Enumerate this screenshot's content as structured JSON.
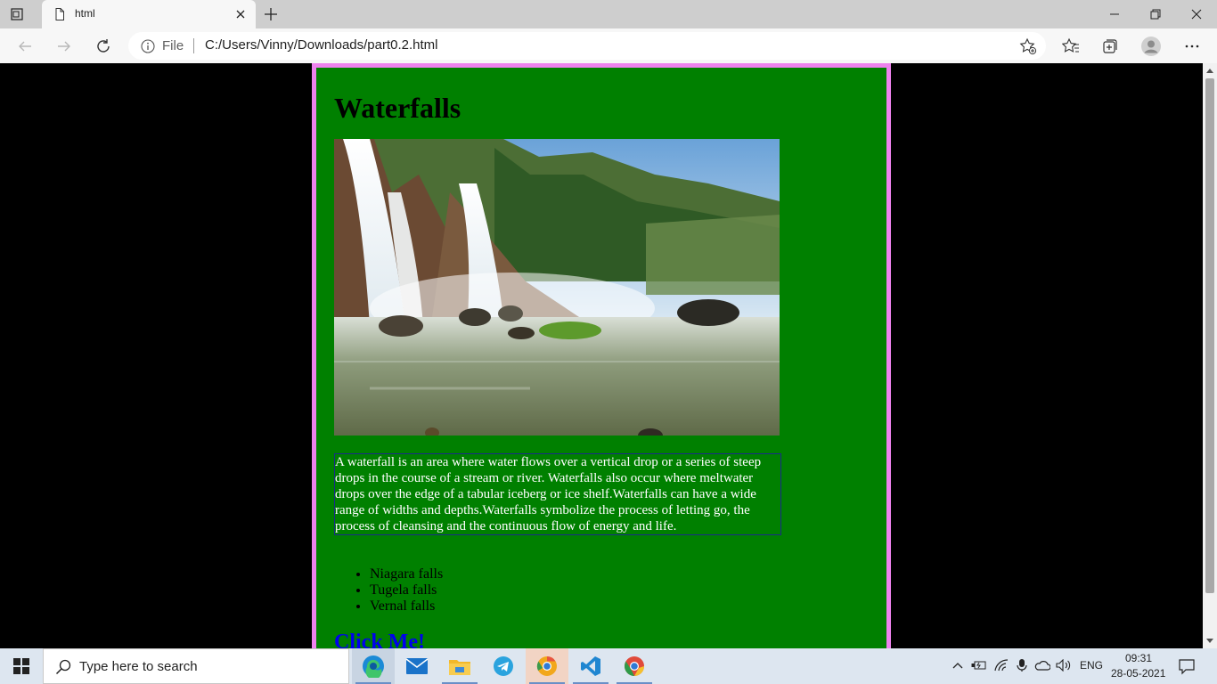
{
  "browser": {
    "tab_title": "html",
    "address_scheme_label": "File",
    "url": "C:/Users/Vinny/Downloads/part0.2.html"
  },
  "page": {
    "heading": "Waterfalls",
    "paragraph": "A waterfall is an area where water flows over a vertical drop or a series of steep drops in the course of a stream or river. Waterfalls also occur where meltwater drops over the edge of a tabular iceberg or ice shelf.Waterfalls can have a wide range of widths and depths.Waterfalls symbolize the process of letting go, the process of cleansing and the continuous flow of energy and life.",
    "list_items": [
      "Niagara falls",
      "Tugela falls",
      "Vernal falls"
    ],
    "link_text": "Click Me!",
    "colors": {
      "background": "#000000",
      "box": "#008000",
      "box_border": "#ee82ee",
      "link": "#0000ee"
    }
  },
  "taskbar": {
    "search_placeholder": "Type here to search",
    "apps": [
      "edge-icon",
      "mail-icon",
      "file-explorer-icon",
      "telegram-icon",
      "chrome-canary-icon",
      "vscode-icon",
      "chrome-icon"
    ],
    "language": "ENG",
    "time": "09:31",
    "date": "28-05-2021"
  }
}
